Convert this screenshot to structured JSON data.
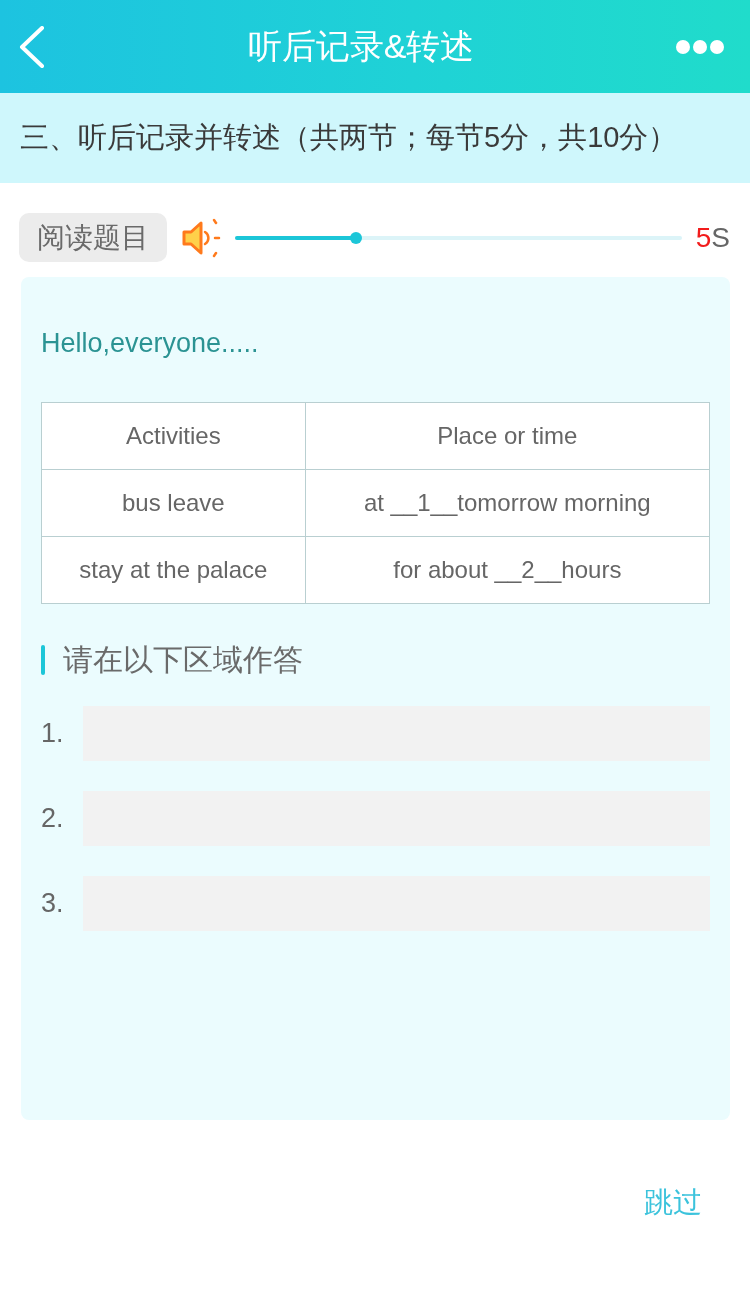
{
  "header": {
    "title": "听后记录&转述"
  },
  "section": {
    "title": "三、听后记录并转述（共两节；每节5分，共10分）"
  },
  "player": {
    "button": "阅读题目",
    "level": 0.27,
    "countdown": {
      "value": "5",
      "unit": "S"
    }
  },
  "passage": {
    "intro": "Hello,everyone.....",
    "table": {
      "columns": [
        "Activities",
        "Place or time"
      ],
      "rows": [
        [
          "bus leave",
          "at __1__tomorrow morning"
        ],
        [
          "stay at the palace",
          "for about __2__hours"
        ]
      ]
    }
  },
  "answer_area": {
    "heading": "请在以下区域作答",
    "answers": [
      {
        "number": "1."
      },
      {
        "number": "2."
      },
      {
        "number": "3."
      }
    ]
  },
  "skip_link": "跳过"
}
